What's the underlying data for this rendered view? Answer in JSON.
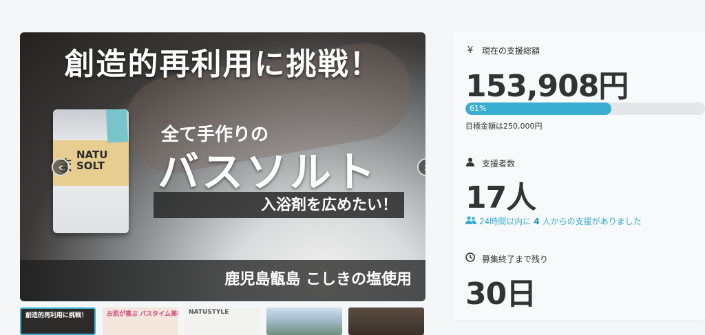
{
  "hero": {
    "title": "創造的再利用に挑戦！",
    "sub1": "全て手作りの",
    "sub2": "バスソルト",
    "sub3": "入浴剤を広めたい！",
    "bottom": "鹿児島甑島 こしきの塩使用",
    "bag_brand_line1": "NATU",
    "bag_brand_line2": "SOLT",
    "prev_arrow": "‹",
    "next_arrow": "›"
  },
  "thumbnails": [
    {
      "text": "創造的再利用に挑戦！",
      "bg": "#2d2b2a",
      "color": "#ffffff"
    },
    {
      "text": "お肌が喜ぶ バスタイム美容を",
      "bg": "#f2e6dd",
      "color": "#d6457a"
    },
    {
      "text": "NATUSTYLE",
      "bg": "#f2f2ee",
      "color": "#555555"
    },
    {
      "text": "",
      "bg": "#9db8c9",
      "color": "#ffffff"
    },
    {
      "text": "",
      "bg": "#4a3f36",
      "color": "#ffffff"
    }
  ],
  "stats": {
    "amount_label": "現在の支援総額",
    "amount_icon": "yen-icon",
    "amount_value": "153,908円",
    "progress_text": "61%",
    "progress_percent": 61,
    "goal_text": "目標金額は250,000円",
    "supporters_label": "支援者数",
    "supporters_icon": "person-icon",
    "supporters_value": "17人",
    "recent_prefix": "24時間以内に",
    "recent_count": "4",
    "recent_suffix": "人からの支援がありました",
    "remaining_label": "募集終了まで残り",
    "remaining_icon": "clock-icon",
    "remaining_value": "30日"
  },
  "colors": {
    "accent": "#3aaed0",
    "text": "#333333"
  }
}
